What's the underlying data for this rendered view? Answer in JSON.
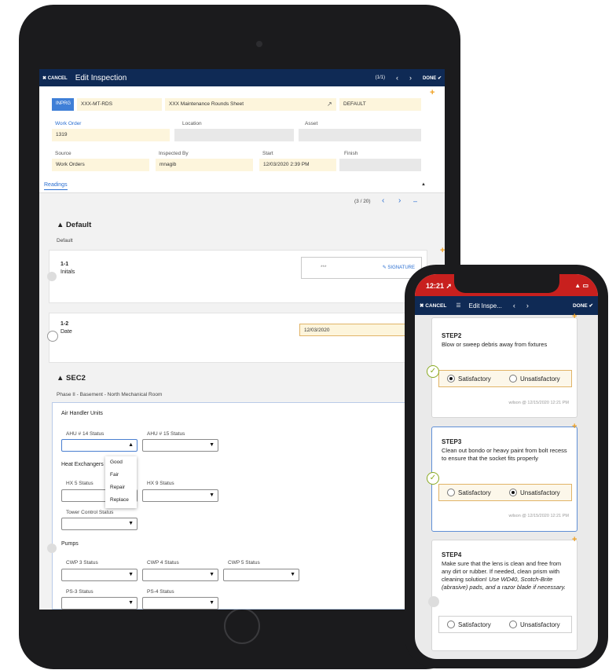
{
  "tablet": {
    "topbar": {
      "cancel_label": "✖ CANCEL",
      "title": "Edit Inspection",
      "pager": "(1/1)",
      "prev": "‹",
      "next": "›",
      "done_label": "DONE ✔"
    },
    "header": {
      "status": "INPRG",
      "form_id": "XXX-MT-RDS",
      "form_name": "XXX Maintenance Rounds Sheet",
      "edit_icon": "↗",
      "default_value": "DEFAULT",
      "work_order_label": "Work Order",
      "work_order_value": "1319",
      "location_label": "Location",
      "asset_label": "Asset",
      "source_label": "Source",
      "source_value": "Work Orders",
      "inspected_by_label": "Inspected By",
      "inspected_by_value": "mnagib",
      "start_label": "Start",
      "start_value": "12/03/2020 2:39 PM",
      "finish_label": "Finish"
    },
    "readings_tab": "Readings",
    "readings_collapse": "▲",
    "readings_pager": "(3 / 20)",
    "readings_prev": "‹",
    "readings_next": "›",
    "readings_minus": "–",
    "default_section": {
      "title": "▲ Default",
      "subtitle": "Default",
      "q1_number": "1-1",
      "q1_label": "Initals",
      "q1_value": "***",
      "signature_label": "✎ SIGNATURE",
      "q2_number": "1-2",
      "q2_label": "Date",
      "q2_value": "12/03/2020"
    },
    "sec2": {
      "title": "▲ SEC2",
      "subtitle": "Phase II - Basement - North Mechanical Room",
      "group1": "Air Handler Units",
      "ahu14": "AHU # 14 Status",
      "ahu15": "AHU # 15 Status",
      "group2": "Heat Exchangers",
      "hx5": "HX 5 Status",
      "hx9": "HX 9 Status",
      "tower": "Tower Control Status",
      "group3": "Pumps",
      "cwp3": "CWP 3 Status",
      "cwp4": "CWP 4 Status",
      "cwp5": "CWP 5 Status",
      "ps3": "PS-3 Status",
      "ps4": "PS-4 Status"
    },
    "dropdown_options": [
      "Good",
      "Fair",
      "Repair",
      "Replace"
    ]
  },
  "phone": {
    "time": "12:21 ➚",
    "status_icons": "▲ ▭",
    "cancel_label": "✖ CANCEL",
    "menu_icon": "☰",
    "title": "Edit Inspe...",
    "prev": "‹",
    "next": "›",
    "done_label": "DONE ✔",
    "steps": [
      {
        "title": "STEP2",
        "text": "Blow or sweep debris away from fixtures",
        "options": [
          "Satisfactory",
          "Unsatisfactory"
        ],
        "selected": "Satisfactory",
        "signature": "wilson @ 12/15/2020 12:21 PM"
      },
      {
        "title": "STEP3",
        "text": "Clean out bondo or heavy paint from bolt recess to ensure that the socket fits properly",
        "options": [
          "Satisfactory",
          "Unsatisfactory"
        ],
        "selected": "Unsatisfactory",
        "signature": "wilson @ 12/15/2020 12:21 PM"
      },
      {
        "title": "STEP4",
        "text_plain": "Make sure that the lens is clean and free from any dirt or rubber. If needed, clean prism with cleaning solution!",
        "text_italic": "Use WD40, Scotch-Brite (abrasive) pads, and a razor blade if necessary.",
        "options": [
          "Satisfactory",
          "Unsatisfactory"
        ]
      }
    ]
  },
  "colors": {
    "navy_bar": "#0f2a55",
    "accent_orange": "#f0a020",
    "link_blue": "#2b6fd1",
    "field_yellow": "#fdf5dc",
    "phone_status_red": "#c8201e",
    "check_green": "#8aaa22"
  }
}
